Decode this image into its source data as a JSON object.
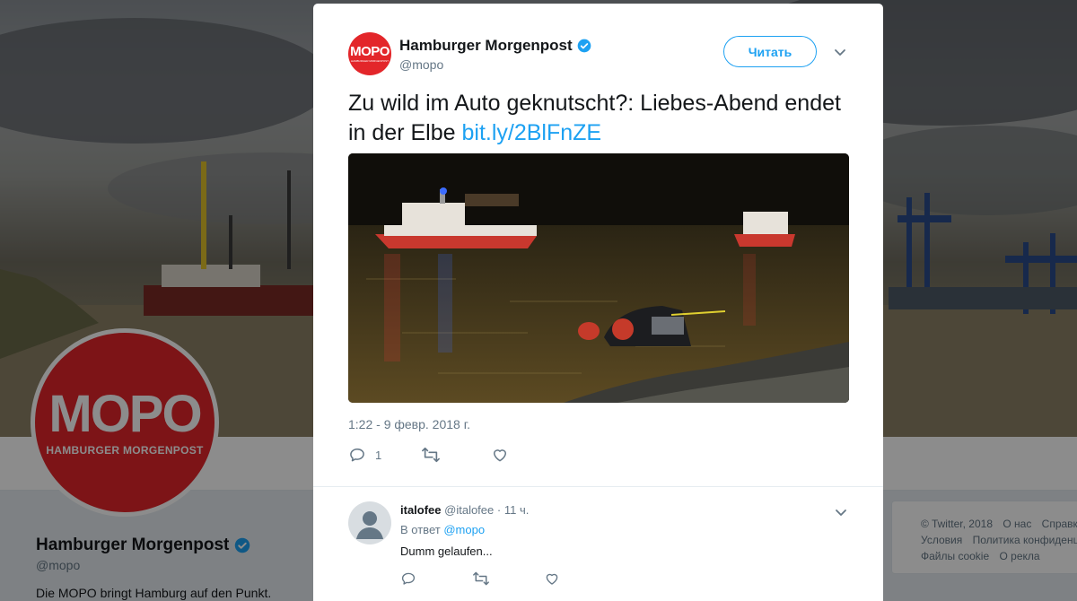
{
  "profile": {
    "name": "Hamburger Morgenpost",
    "handle": "@mopo",
    "bio": "Die MOPO bringt Hamburg auf den Punkt.",
    "avatar_text": "MOPO",
    "avatar_subtext": "HAMBURGER MORGENPOST"
  },
  "footer": {
    "row1": [
      "© Twitter, 2018",
      "О нас",
      "Справк"
    ],
    "row2": [
      "Условия",
      "Политика конфиденц"
    ],
    "row3": [
      "Файлы cookie",
      "О рекла"
    ]
  },
  "tweet": {
    "author_name": "Hamburger Morgenpost",
    "author_handle": "@mopo",
    "avatar_text": "MOPO",
    "avatar_subtext": "HAMBURGER MORGENPOST",
    "follow_label": "Читать",
    "text": "Zu wild im Auto geknutscht?: Liebes-Abend endet in der Elbe",
    "link": "bit.ly/2BlFnZE",
    "timestamp": "1:22 - 9 февр. 2018 г.",
    "reply_count": "1"
  },
  "reply": {
    "name": "italofee",
    "handle": "@italofee",
    "time": "· 11 ч.",
    "reply_to_prefix": "В ответ",
    "reply_to_handle": "@mopo",
    "text": "Dumm gelaufen..."
  },
  "colors": {
    "accent": "#1da1f2",
    "brand_red": "#e3262a",
    "verified": "#1da1f2"
  },
  "icons": [
    "verified-badge-icon",
    "chevron-down-icon",
    "reply-icon",
    "retweet-icon",
    "like-icon",
    "default-avatar-icon"
  ]
}
